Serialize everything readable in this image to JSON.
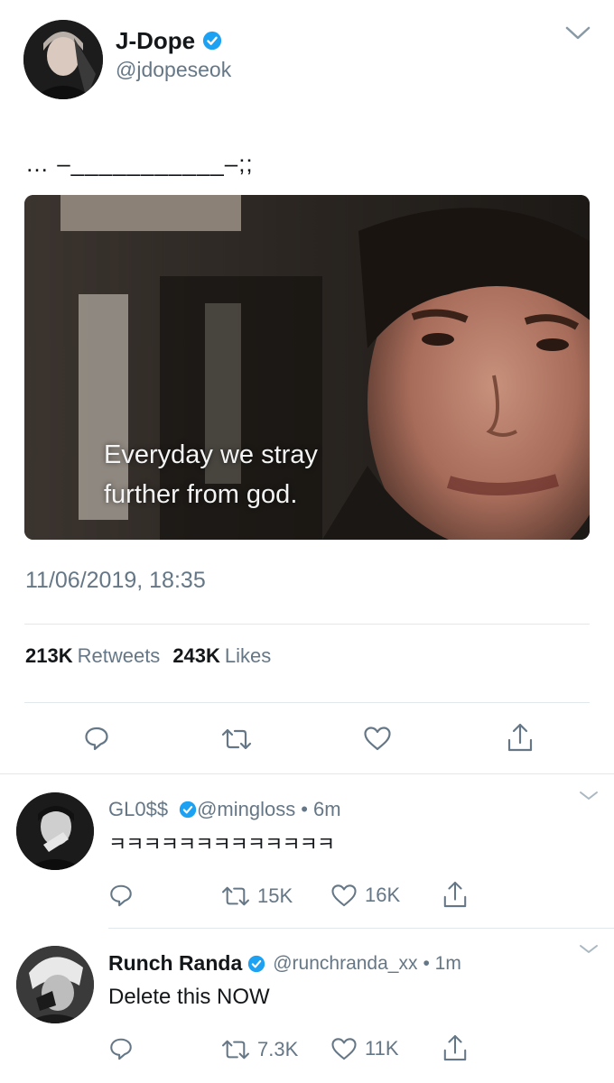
{
  "main_tweet": {
    "display_name": "J-Dope",
    "handle": "@jdopeseok",
    "text": "… –___________–;;",
    "image_caption_line1": "Everyday we stray",
    "image_caption_line2": "further from god.",
    "timestamp": "11/06/2019, 18:35",
    "retweets_count": "213K",
    "retweets_label": "Retweets",
    "likes_count": "243K",
    "likes_label": "Likes",
    "actions": [
      "reply-icon",
      "retweet-icon",
      "heart-icon",
      "share-icon"
    ]
  },
  "replies": [
    {
      "display_name": "GL0$$",
      "handle": "@mingloss",
      "time": "• 6m",
      "text": "ㅋㅋㅋㅋㅋㅋㅋㅋㅋㅋㅋㅋㅋ",
      "retweets": "15K",
      "likes": "16K"
    },
    {
      "display_name": "Runch Randa",
      "handle": "@runchranda_xx",
      "time": "• 1m",
      "text": "Delete this NOW",
      "retweets": "7.3K",
      "likes": "11K"
    }
  ],
  "colors": {
    "verified_blue": "#1da1f2",
    "secondary_text": "#657786",
    "divider": "#e1e8ed"
  }
}
